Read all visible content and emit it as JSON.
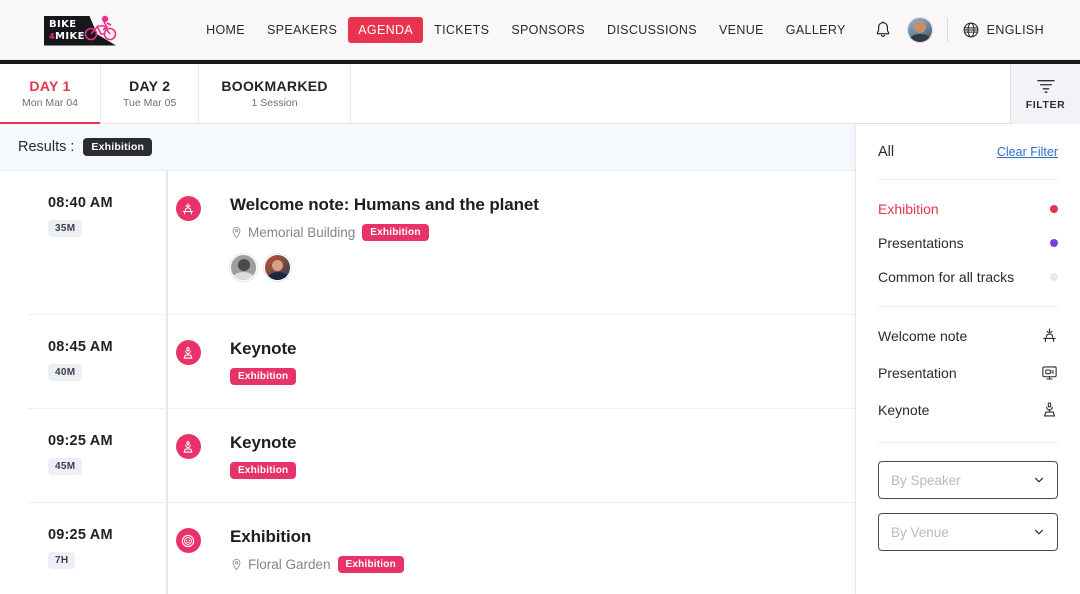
{
  "navbar": {
    "logo": {
      "line1": "BIKE",
      "line2_sup": "4",
      "line2": "MIKE",
      "name": "bike-4-mike-logo"
    },
    "links": [
      {
        "label": "HOME",
        "active": false
      },
      {
        "label": "SPEAKERS",
        "active": false
      },
      {
        "label": "AGENDA",
        "active": true
      },
      {
        "label": "TICKETS",
        "active": false
      },
      {
        "label": "SPONSORS",
        "active": false
      },
      {
        "label": "DISCUSSIONS",
        "active": false
      },
      {
        "label": "VENUE",
        "active": false
      },
      {
        "label": "GALLERY",
        "active": false
      }
    ],
    "language": "ENGLISH",
    "accent_color": "#e8344e"
  },
  "tabs": [
    {
      "title": "DAY 1",
      "subtitle": "Mon Mar 04",
      "active": true
    },
    {
      "title": "DAY 2",
      "subtitle": "Tue Mar 05",
      "active": false
    },
    {
      "title": "BOOKMARKED",
      "subtitle": "1 Session",
      "active": false
    }
  ],
  "filter_button": {
    "label": "FILTER"
  },
  "results": {
    "label": "Results :",
    "chip": "Exhibition"
  },
  "sessions": [
    {
      "time": "08:40 AM",
      "duration": "35M",
      "title": "Welcome note: Humans and the planet",
      "venue": "Memorial Building",
      "tag": "Exhibition",
      "icon": "welcome-note-icon",
      "speakers": 2
    },
    {
      "time": "08:45 AM",
      "duration": "40M",
      "title": "Keynote",
      "venue": "",
      "tag": "Exhibition",
      "icon": "keynote-icon",
      "speakers": 0
    },
    {
      "time": "09:25 AM",
      "duration": "45M",
      "title": "Keynote",
      "venue": "",
      "tag": "Exhibition",
      "icon": "keynote-icon",
      "speakers": 0
    },
    {
      "time": "09:25 AM",
      "duration": "7H",
      "title": "Exhibition",
      "venue": "Floral Garden",
      "tag": "Exhibition",
      "icon": "exhibition-icon",
      "speakers": 0
    }
  ],
  "filter_panel": {
    "all_label": "All",
    "clear_label": "Clear Filter",
    "tracks": [
      {
        "label": "Exhibition",
        "color": "#e8344e",
        "selected": true
      },
      {
        "label": "Presentations",
        "color": "#7b3fe4",
        "selected": false
      },
      {
        "label": "Common for all tracks",
        "color": "#e9e9ee",
        "selected": false
      }
    ],
    "types": [
      {
        "label": "Welcome note",
        "icon": "welcome-note-icon"
      },
      {
        "label": "Presentation",
        "icon": "presentation-icon"
      },
      {
        "label": "Keynote",
        "icon": "keynote-icon"
      }
    ],
    "selects": [
      {
        "placeholder": "By Speaker",
        "name": "by-speaker-select"
      },
      {
        "placeholder": "By Venue",
        "name": "by-venue-select"
      }
    ]
  }
}
